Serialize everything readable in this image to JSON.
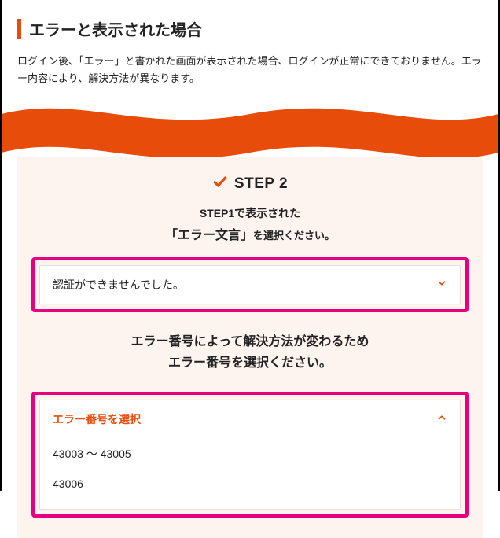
{
  "header": {
    "title": "エラーと表示された場合",
    "intro": "ログイン後、「エラー」と書かれた画面が表示された場合、ログインが正常にできておりません。エラー内容により、解決方法が異なります。"
  },
  "step": {
    "label": "STEP 2",
    "sub1": "STEP1で表示された",
    "sub2_bold": "「エラー文言」",
    "sub2_small": "を選択ください。"
  },
  "dropdown1": {
    "selected": "認証ができませんでした。"
  },
  "mid": {
    "line1": "エラー番号によって解決方法が変わるため",
    "line2": "エラー番号を選択ください。"
  },
  "dropdown2": {
    "title": "エラー番号を選択",
    "items": [
      "43003 〜 43005",
      "43006"
    ]
  },
  "colors": {
    "accent": "#e84c0a",
    "highlight": "#e6007e",
    "panel": "#fdf4ef"
  }
}
